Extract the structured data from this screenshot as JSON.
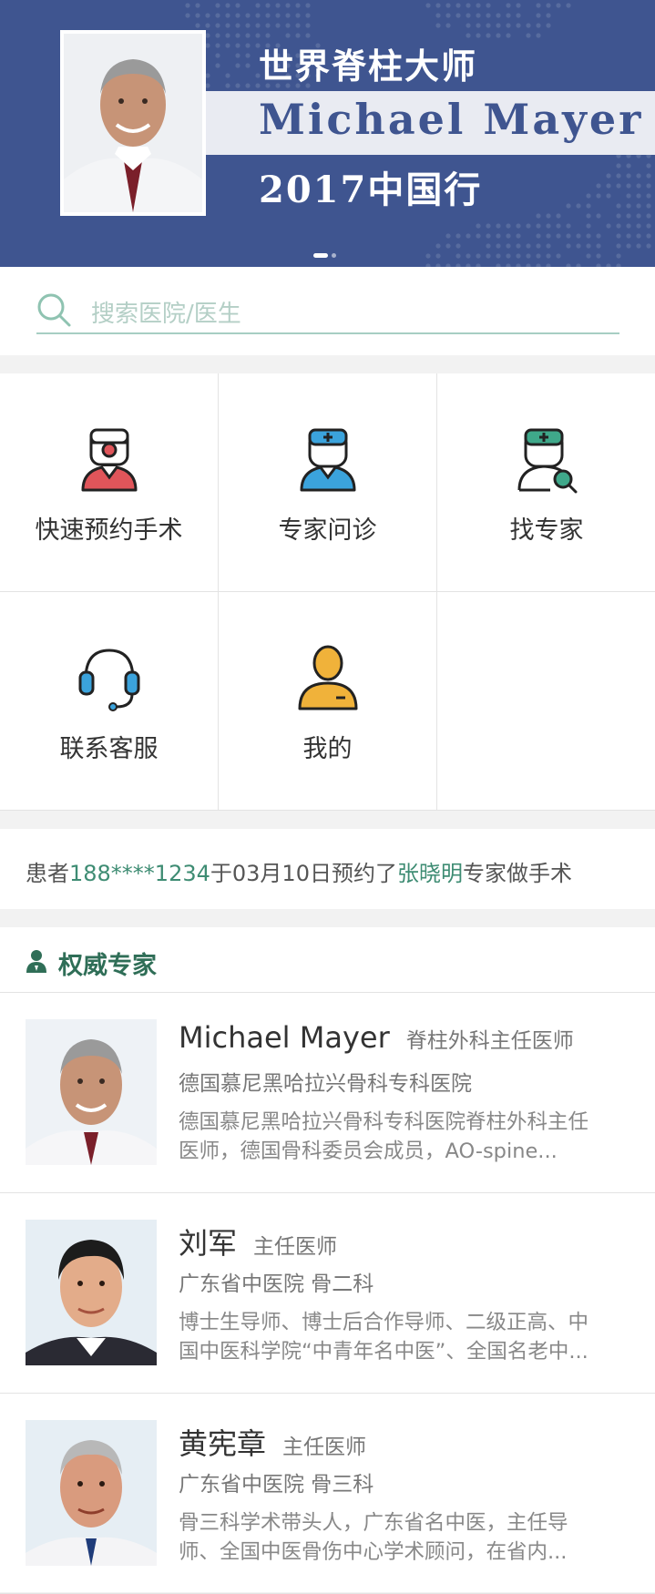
{
  "banner": {
    "line1": "世界脊柱大师",
    "line2": "Michael  Mayer",
    "line3": "2017中国行",
    "page_index": 1,
    "page_count": 2
  },
  "search": {
    "placeholder": "搜索医院/医生"
  },
  "menu": [
    {
      "label": "快速预约手术",
      "icon": "surgeon-icon",
      "color": "#e0555a"
    },
    {
      "label": "专家问诊",
      "icon": "doctor-icon",
      "color": "#3ba3dc"
    },
    {
      "label": "找专家",
      "icon": "find-doctor-icon",
      "color": "#3fa88a"
    },
    {
      "label": "联系客服",
      "icon": "headset-icon",
      "color": "#3ba3dc"
    },
    {
      "label": "我的",
      "icon": "user-icon",
      "color": "#f0b23a"
    }
  ],
  "notice": {
    "prefix": "患者",
    "phone": "188****1234",
    "middle": "于03月10日预约了",
    "doctor": "张晓明",
    "suffix": "专家做手术"
  },
  "experts": {
    "title": "权威专家",
    "list": [
      {
        "name": "Michael Mayer",
        "title": "脊柱外科主任医师",
        "hospital": "德国慕尼黑哈拉兴骨科专科医院",
        "desc_line1": "德国慕尼黑哈拉兴骨科专科医院脊柱外科主任",
        "desc_line2": "医师，德国骨科委员会成员，AO-spine..."
      },
      {
        "name": "刘军",
        "title": "主任医师",
        "hospital": "广东省中医院   骨二科",
        "desc_line1": "博士生导师、博士后合作导师、二级正高、中",
        "desc_line2": "国中医科学院“中青年名中医”、全国名老中..."
      },
      {
        "name": "黄宪章",
        "title": "主任医师",
        "hospital": "广东省中医院   骨三科",
        "desc_line1": "骨三科学术带头人，广东省名中医，主任导",
        "desc_line2": "师、全国中医骨伤中心学术顾问，在省内..."
      }
    ]
  },
  "colors": {
    "banner_bg": "#3f5590",
    "accent_green": "#3e8c73"
  }
}
